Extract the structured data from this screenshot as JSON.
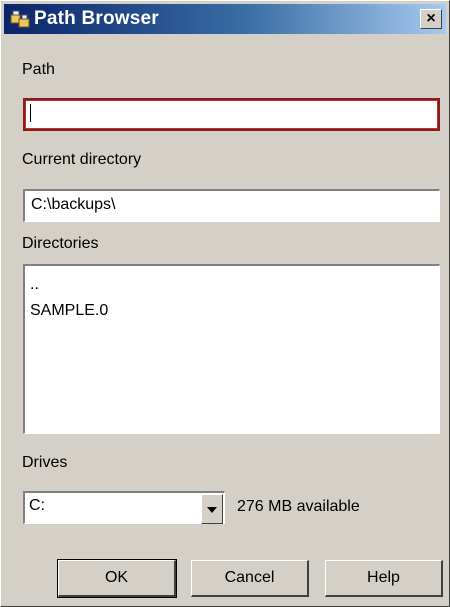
{
  "window": {
    "title": "Path Browser",
    "close_glyph": "×"
  },
  "path": {
    "label": "Path",
    "value": ""
  },
  "current_directory": {
    "label": "Current directory",
    "value": "C:\\backups\\"
  },
  "directories": {
    "label": "Directories",
    "items": [
      "..",
      "SAMPLE.0"
    ]
  },
  "drives": {
    "label": "Drives",
    "selected": "C:",
    "available": "276 MB available"
  },
  "buttons": {
    "ok": "OK",
    "cancel": "Cancel",
    "help": "Help"
  },
  "colors": {
    "title_bar_start": "#0a246a",
    "title_bar_end": "#a6caf0",
    "dialog_face": "#d4d0c8",
    "focus_border": "#8b1a1a"
  }
}
